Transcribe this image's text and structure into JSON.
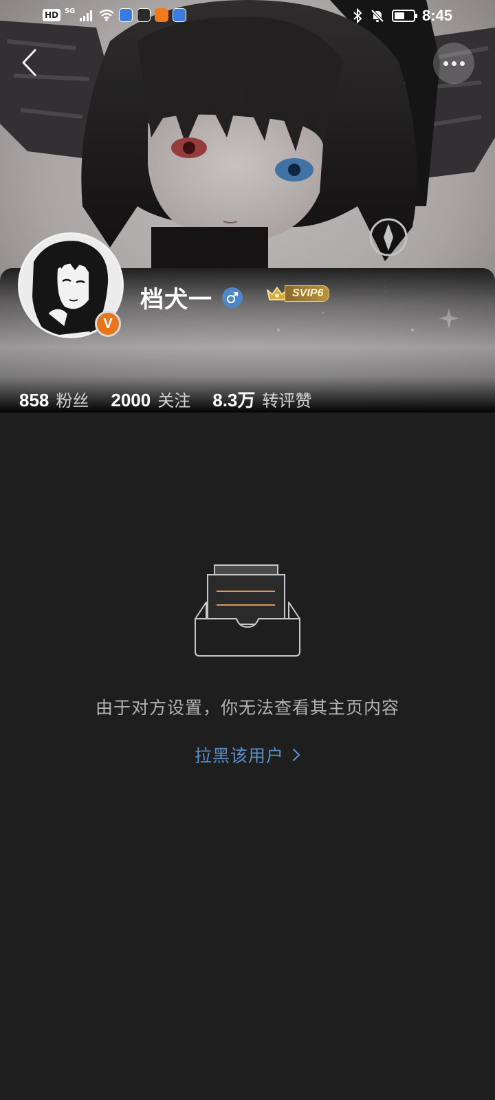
{
  "status_bar": {
    "network_badge": "HD",
    "network_type": "5G",
    "time": "8:45",
    "battery_level": 0.55,
    "icons": [
      "signal-icon",
      "wifi-icon",
      "bluetooth-icon",
      "mute-bell-icon",
      "battery-icon"
    ],
    "app_icons": [
      "browser-app-icon",
      "game-app-icon",
      "video-app-icon",
      "browser-app-icon"
    ]
  },
  "nav": {
    "back_icon": "chevron-left-icon",
    "more_icon": "more-dots-icon"
  },
  "profile": {
    "name": "档犬一",
    "gender_icon": "male-icon",
    "verify_mark": "V",
    "vip_label": "SVIP6",
    "stats": [
      {
        "num": "858",
        "label": "粉丝"
      },
      {
        "num": "2000",
        "label": "关注"
      },
      {
        "num": "8.3万",
        "label": "转评赞"
      }
    ]
  },
  "empty_state": {
    "icon": "empty-drawer-icon",
    "message": "由于对方设置，你无法查看其主页内容",
    "block_link": "拉黑该用户"
  },
  "colors": {
    "background": "#1e1e1e",
    "link": "#5c8fc6",
    "verify": "#e8741c",
    "gender": "#4f88c6",
    "vip_gold": "#b8923f"
  }
}
